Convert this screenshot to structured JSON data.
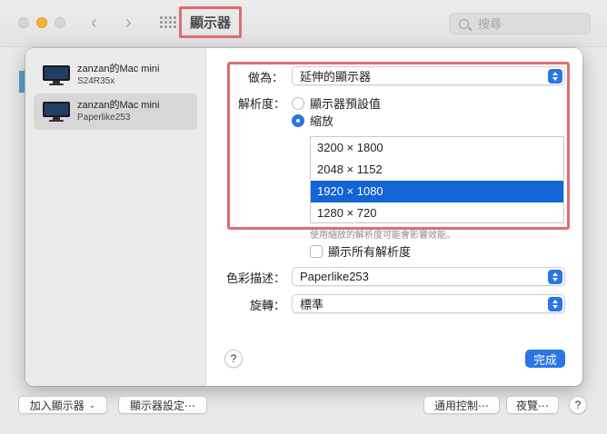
{
  "window": {
    "title": "顯示器",
    "search_placeholder": "搜尋"
  },
  "sidebar": {
    "displays": [
      {
        "name": "zanzan的Mac mini",
        "model": "S24R35x"
      },
      {
        "name": "zanzan的Mac mini",
        "model": "Paperlike253"
      }
    ]
  },
  "settings": {
    "use_as_label": "做為：",
    "use_as_value": "延伸的顯示器",
    "resolution_label": "解析度：",
    "radio_default": "顯示器預設值",
    "radio_scaled": "縮放",
    "resolutions": [
      "3200 × 1800",
      "2048 × 1152",
      "1920 × 1080",
      "1280 × 720"
    ],
    "selected_resolution": "1920 × 1080",
    "note": "使用縮放的解析度可能會影響效能。",
    "show_all_label": "顯示所有解析度",
    "color_profile_label": "色彩描述：",
    "color_profile_value": "Paperlike253",
    "rotation_label": "旋轉：",
    "rotation_value": "標準",
    "help": "?",
    "done": "完成"
  },
  "bottom": {
    "add_display": "加入顯示器",
    "display_settings": "顯示器設定⋯",
    "universal_control": "通用控制⋯",
    "night_shift": "夜覽⋯",
    "help": "?"
  },
  "colors": {
    "accent": "#2a76e4",
    "selection": "#1364d4",
    "annotation": "#e06d6b"
  }
}
